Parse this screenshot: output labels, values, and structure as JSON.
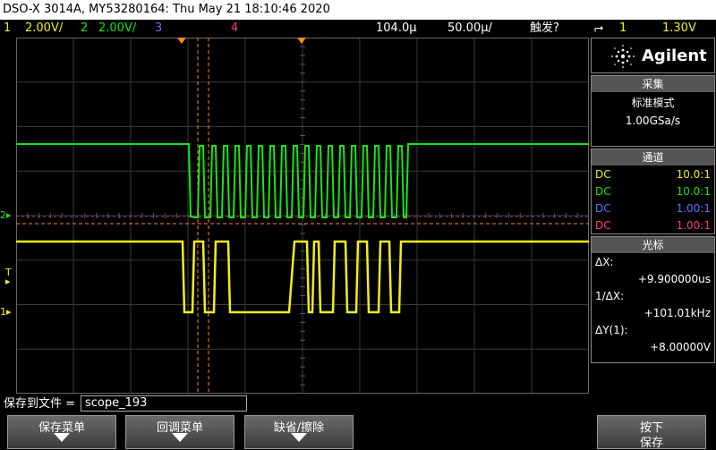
{
  "title": "DSO-X 3014A, MY53280164: Thu May 21 18:10:46 2020",
  "channel_bar": {
    "ch1_num": "1",
    "ch1_scale": "2.00V/",
    "ch2_num": "2",
    "ch2_scale": "2.00V/",
    "ch3_num": "3",
    "ch4_num": "4",
    "timebase": "104.0µ",
    "time_scale": "50.00µ/",
    "trigger_mode": "触发?",
    "trigger_source": "1",
    "trigger_level": "1.30V"
  },
  "colors": {
    "ch1": "#f2ee19",
    "ch2": "#18e418",
    "ch3": "#6c6cff",
    "ch4": "#ff3a7c",
    "cursor": "#ff8c1a",
    "grid": "#3a3a3a"
  },
  "markers": {
    "ch2_marker": "2",
    "ch1_marker": "1",
    "trigger_marker": "T"
  },
  "logo": {
    "brand": "Agilent"
  },
  "acquire": {
    "header": "采集",
    "mode": "标准模式",
    "rate": "1.00GSa/s"
  },
  "channels_panel": {
    "header": "通道",
    "rows": [
      {
        "coupling": "DC",
        "probe": "10.0:1"
      },
      {
        "coupling": "DC",
        "probe": "10.0:1"
      },
      {
        "coupling": "DC",
        "probe": "1.00:1"
      },
      {
        "coupling": "DC",
        "probe": "1.00:1"
      }
    ]
  },
  "cursor_panel": {
    "header": "光标",
    "dx_label": "ΔX:",
    "dx_value": "+9.900000us",
    "inv_dx_label": "1/ΔX:",
    "inv_dx_value": "+101.01kHz",
    "dy_label": "ΔY(1):",
    "dy_value": "+8.00000V"
  },
  "save_bar": {
    "file_label": "保存到文件 =",
    "file_name": "scope_193",
    "softkeys": [
      "保存菜单",
      "回调菜单",
      "缺省/擦除"
    ],
    "press_label": "按下",
    "save_label": "保存"
  }
}
